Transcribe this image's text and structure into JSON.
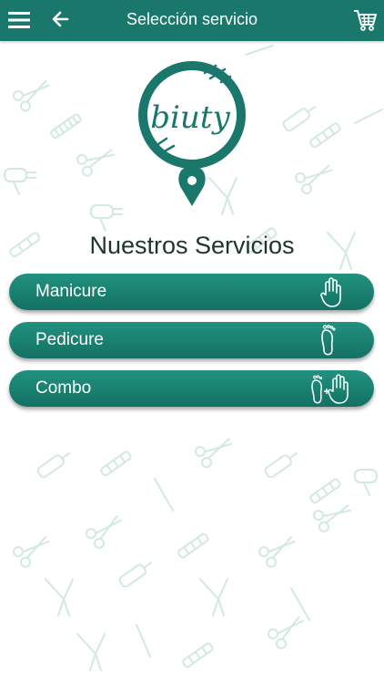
{
  "header": {
    "title": "Selección servicio",
    "icons": [
      "hamburger-menu-icon",
      "arrow-back-icon",
      "shopping-cart-icon"
    ]
  },
  "logo": {
    "text": "biuty"
  },
  "main": {
    "heading": "Nuestros Servicios",
    "services": [
      {
        "label": "Manicure",
        "icon": "hand-icon"
      },
      {
        "label": "Pedicure",
        "icon": "foot-icon"
      },
      {
        "label": "Combo",
        "icon": "foot-plus-hand-icon"
      }
    ]
  },
  "colors": {
    "primary": "#19786b",
    "button_gradient_top": "#22917f",
    "button_gradient_bottom": "#137163",
    "heading_text": "#1e3431",
    "pattern": "#cfe6e1"
  }
}
